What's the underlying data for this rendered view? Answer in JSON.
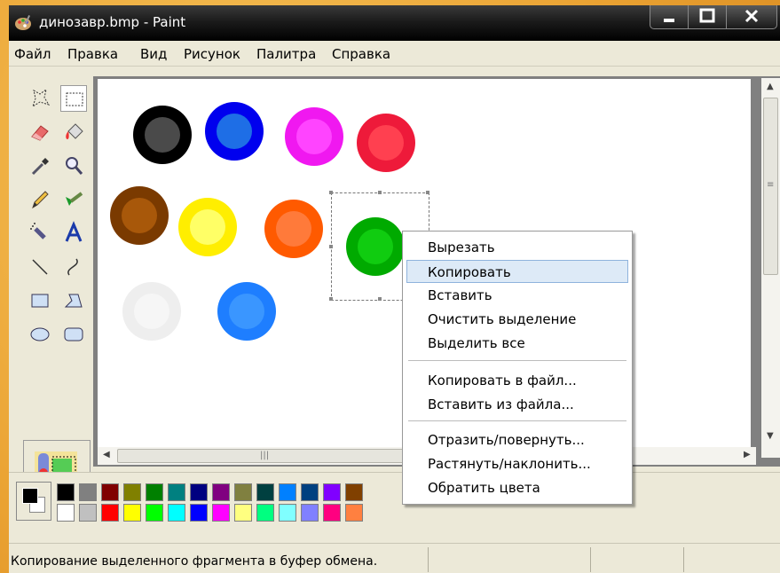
{
  "window": {
    "title": "динозавр.bmp - Paint"
  },
  "menubar": [
    "Файл",
    "Правка",
    "Вид",
    "Рисунок",
    "Палитра",
    "Справка"
  ],
  "toolbox": {
    "tools": [
      "free-select",
      "rect-select",
      "eraser",
      "fill",
      "color-picker",
      "magnifier",
      "pencil",
      "brush",
      "airbrush",
      "text",
      "line",
      "curve",
      "rectangle",
      "polygon",
      "ellipse",
      "rounded-rectangle"
    ],
    "selected": "rect-select",
    "options": [
      "opaque-selection",
      "transparent-selection"
    ],
    "selected_option": "transparent-selection"
  },
  "canvas": {
    "circles": [
      {
        "outer": "#000000",
        "inner": "#4a4a4a"
      },
      {
        "outer": "#0000ee",
        "inner": "#1e6ee6"
      },
      {
        "outer": "#f018f0",
        "inner": "#ff44ff"
      },
      {
        "outer": "#ee1a3a",
        "inner": "#ff4050"
      },
      {
        "outer": "#7a3a00",
        "inner": "#a8580a"
      },
      {
        "outer": "#ffee00",
        "inner": "#ffff66"
      },
      {
        "outer": "#ff5a00",
        "inner": "#ff7a3a"
      },
      {
        "outer": "#00aa00",
        "inner": "#10cc10"
      },
      {
        "outer": "#eeeeee",
        "inner": "#f6f6f6"
      },
      {
        "outer": "#1e7eff",
        "inner": "#3a96ff"
      }
    ]
  },
  "context_menu": {
    "groups": [
      [
        "Вырезать",
        "Копировать",
        "Вставить",
        "Очистить выделение",
        "Выделить все"
      ],
      [
        "Копировать в файл...",
        "Вставить из файла..."
      ],
      [
        "Отразить/повернуть...",
        "Растянуть/наклонить...",
        "Обратить цвета"
      ]
    ],
    "highlighted": "Копировать"
  },
  "palette": {
    "foreground": "#000000",
    "background": "#ffffff",
    "colors_row1": [
      "#000000",
      "#808080",
      "#800000",
      "#808000",
      "#008000",
      "#008080",
      "#000080",
      "#800080",
      "#808040",
      "#004040",
      "#0080ff",
      "#004080",
      "#8000ff",
      "#804000"
    ],
    "colors_row2": [
      "#ffffff",
      "#c0c0c0",
      "#ff0000",
      "#ffff00",
      "#00ff00",
      "#00ffff",
      "#0000ff",
      "#ff00ff",
      "#ffff80",
      "#00ff80",
      "#80ffff",
      "#8080ff",
      "#ff0080",
      "#ff8040"
    ]
  },
  "statusbar": {
    "text": "Копирование выделенного фрагмента в буфер обмена."
  }
}
